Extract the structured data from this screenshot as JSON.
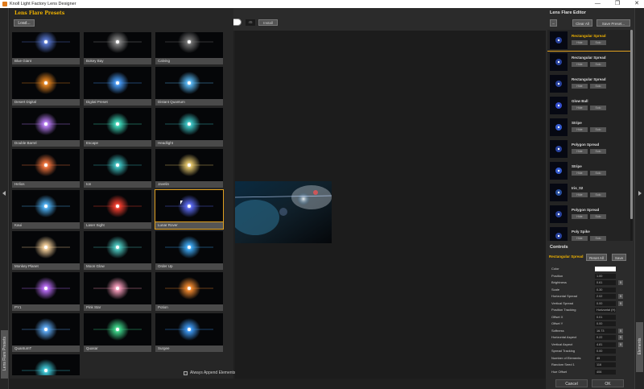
{
  "window": {
    "title": "Knoll Light Factory Lens Designer",
    "minimize": "—",
    "maximize": "❐",
    "close": "✕"
  },
  "left_tab": {
    "label": "Lens Flare Presets"
  },
  "right_tab": {
    "label": "Elements"
  },
  "presets": {
    "title": "Lens Flare Presets",
    "load_label": "Load...",
    "search_placeholder": "",
    "count": "45",
    "install_label": "Install",
    "always_append_label": "Always Append Elements",
    "items": [
      {
        "label": "Blue Giant",
        "color": "#5a7bd8"
      },
      {
        "label": "Bokey Bay",
        "color": "#888888"
      },
      {
        "label": "Calving",
        "color": "#777777"
      },
      {
        "label": "Desert Digital",
        "color": "#f08a20"
      },
      {
        "label": "Digital Preset",
        "color": "#4aa0ff"
      },
      {
        "label": "Distant Quantum",
        "color": "#5cc0ff"
      },
      {
        "label": "Double Barrel",
        "color": "#c080ff"
      },
      {
        "label": "Escape",
        "color": "#40e0c0"
      },
      {
        "label": "Headlight",
        "color": "#40d0d0"
      },
      {
        "label": "Helios",
        "color": "#ff7a40"
      },
      {
        "label": "Ion",
        "color": "#40c8c8"
      },
      {
        "label": "Javelin",
        "color": "#f0d070"
      },
      {
        "label": "Kaui",
        "color": "#50b8ff"
      },
      {
        "label": "Laser Sight",
        "color": "#ff4030"
      },
      {
        "label": "Lunar Rover",
        "color": "#6070ff"
      },
      {
        "label": "Monkey Planet",
        "color": "#ffd8a0"
      },
      {
        "label": "Moon Glow",
        "color": "#50d0c8"
      },
      {
        "label": "Order Up",
        "color": "#40b0ff"
      },
      {
        "label": "PY1",
        "color": "#c070ff"
      },
      {
        "label": "Pink Star",
        "color": "#ffa0c0"
      },
      {
        "label": "Potion",
        "color": "#ff9030"
      },
      {
        "label": "QuantumT",
        "color": "#60b0ff"
      },
      {
        "label": "Quasar",
        "color": "#40e090"
      },
      {
        "label": "Surgee",
        "color": "#40a0ff"
      },
      {
        "label": "",
        "color": "#40d0e0"
      }
    ]
  },
  "editor": {
    "title": "Lens Flare Editor",
    "minus_label": "–",
    "clear_all_label": "Clear All",
    "save_preset_label": "Save Preset...",
    "hide_label": "Hide",
    "solo_label": "Solo",
    "elements": [
      {
        "name": "Rectangular Spread",
        "color": "#3050c0"
      },
      {
        "name": "Rectangular Spread",
        "color": "#3050c0"
      },
      {
        "name": "Rectangular Spread",
        "color": "#3050c0"
      },
      {
        "name": "Glow Ball",
        "color": "#4060ff"
      },
      {
        "name": "Stripe",
        "color": "#4070ff"
      },
      {
        "name": "Polygon Spread",
        "color": "#3050c0"
      },
      {
        "name": "Stripe",
        "color": "#4070ff"
      },
      {
        "name": "Iris_02",
        "color": "#3060c0"
      },
      {
        "name": "Polygon Spread",
        "color": "#3050c0"
      },
      {
        "name": "Poly Spike",
        "color": "#3050c0"
      }
    ]
  },
  "controls": {
    "title": "Controls",
    "element_name": "Rectangular Spread",
    "reset_all_label": "Reset All",
    "save_label": "Save",
    "params": [
      {
        "label": "Color",
        "value": "",
        "white": true,
        "btn": ""
      },
      {
        "label": "Position",
        "value": "1.00",
        "btn": ""
      },
      {
        "label": "Brightness",
        "value": "0.61",
        "btn": "B"
      },
      {
        "label": "Scale",
        "value": "0.30",
        "btn": ""
      },
      {
        "label": "Horizontal Spread",
        "value": "2.02",
        "btn": "B"
      },
      {
        "label": "Vertical Spread",
        "value": "0.00",
        "btn": "B"
      },
      {
        "label": "Position Tracking",
        "value": "Horizontal (H)",
        "btn": ""
      },
      {
        "label": "Offset X",
        "value": "0.01",
        "btn": ""
      },
      {
        "label": "Offset Y",
        "value": "0.00",
        "btn": ""
      },
      {
        "label": "Softness",
        "value": "16.73",
        "btn": "B"
      },
      {
        "label": "Horizontal Aspect",
        "value": "0.22",
        "btn": "B"
      },
      {
        "label": "Vertical Aspect",
        "value": "4.81",
        "btn": "B"
      },
      {
        "label": "Spread Tracking",
        "value": "0.00",
        "btn": ""
      },
      {
        "label": "Number of Elements",
        "value": "45",
        "btn": ""
      },
      {
        "label": "Random Seed 1",
        "value": "116",
        "btn": ""
      },
      {
        "label": "Hue Offset",
        "value": "406",
        "btn": ""
      }
    ]
  },
  "footer": {
    "cancel_label": "Cancel",
    "ok_label": "OK"
  }
}
